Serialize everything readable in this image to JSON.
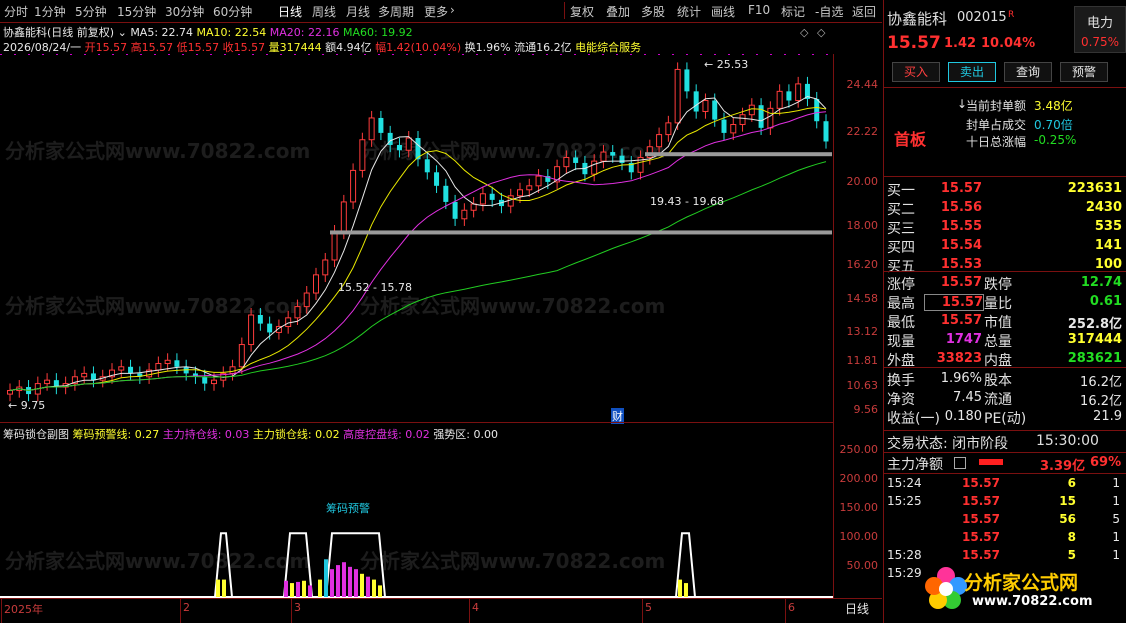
{
  "toolbar": {
    "periods": [
      "分时",
      "1分钟",
      "5分钟",
      "15分钟",
      "30分钟",
      "60分钟",
      "日线",
      "周线",
      "月线",
      "多周期",
      "更多"
    ],
    "tools": [
      "复权",
      "叠加",
      "多股",
      "统计",
      "画线",
      "F10",
      "标记",
      "-自选",
      "返回"
    ]
  },
  "chart_header": {
    "title": "协鑫能科(日线 前复权)",
    "ma5": "MA5: 22.74",
    "ma10": "MA10: 22.54",
    "ma20": "MA20: 22.16",
    "ma60": "MA60: 19.92"
  },
  "quote_line": {
    "date": "2026/08/24/一",
    "open": "开15.57",
    "high": "高15.57",
    "low": "低15.57",
    "close": "收15.57",
    "volume": "量317444",
    "amount": "额4.94亿",
    "change": "幅1.42(10.04%)",
    "turnover": "换1.96%",
    "float": "流通16.2亿",
    "industry": "电能综合服务"
  },
  "price_axis": [
    "24.44",
    "22.22",
    "20.00",
    "18.00",
    "16.20",
    "14.58",
    "13.12",
    "11.81",
    "10.63",
    "9.56"
  ],
  "annotations": {
    "high": "25.53",
    "low": "9.75",
    "range1": "15.52 - 15.78",
    "range2": "19.43 - 19.68",
    "cai": "财"
  },
  "sub_header": {
    "title": "筹码锁仓副图",
    "warn": "筹码预警线: 0.27",
    "hold": "主力持仓线: 0.03",
    "lock": "主力锁仓线: 0.02",
    "control": "高度控盘线: 0.02",
    "strong": "强势区: 0.00"
  },
  "sub_axis": [
    "250.00",
    "200.00",
    "150.00",
    "100.00",
    "50.00"
  ],
  "sub_label": "筹码预警",
  "x_axis": [
    "2025年",
    "2",
    "3",
    "4",
    "5",
    "6"
  ],
  "period_tag": "日线",
  "watermark": "分析家公式网www.70822.com",
  "chart_data": {
    "type": "candlestick",
    "title": "协鑫能科(日线 前复权)",
    "ylim": [
      9.56,
      25.53
    ],
    "x_ticks": [
      "2025年",
      "2",
      "3",
      "4",
      "5",
      "6"
    ],
    "high_marker": 25.53,
    "low_marker": 9.75,
    "levels": [
      [
        15.52,
        15.78
      ],
      [
        19.43,
        19.68
      ]
    ],
    "series": [
      {
        "name": "MA5",
        "last": 22.74
      },
      {
        "name": "MA10",
        "last": 22.54
      },
      {
        "name": "MA20",
        "last": 22.16
      },
      {
        "name": "MA60",
        "last": 19.92
      }
    ],
    "closes": [
      10.1,
      10.2,
      10.0,
      10.3,
      10.4,
      10.2,
      10.3,
      10.5,
      10.6,
      10.4,
      10.5,
      10.7,
      10.8,
      10.6,
      10.5,
      10.7,
      10.9,
      11.0,
      10.8,
      10.6,
      10.5,
      10.3,
      10.4,
      10.6,
      10.8,
      11.5,
      12.5,
      12.2,
      11.9,
      12.1,
      12.4,
      12.8,
      13.3,
      14.0,
      14.6,
      15.8,
      17.2,
      18.8,
      20.5,
      21.8,
      20.9,
      20.2,
      19.9,
      20.6,
      19.4,
      18.7,
      18.0,
      17.2,
      16.4,
      16.8,
      17.1,
      17.6,
      17.3,
      17.0,
      17.5,
      17.8,
      18.0,
      18.5,
      18.2,
      19.0,
      19.5,
      19.2,
      18.6,
      19.3,
      19.8,
      19.6,
      19.2,
      18.7,
      19.5,
      20.1,
      20.8,
      21.5,
      25.0,
      23.5,
      22.2,
      22.9,
      21.7,
      20.9,
      21.4,
      22.0,
      22.6,
      21.2,
      22.4,
      23.5,
      22.9,
      24.0,
      23.0,
      21.6,
      20.4
    ],
    "sub_chart": {
      "title": "筹码锁仓副图",
      "ylim": [
        0,
        250
      ],
      "warn_line": 0.27,
      "hold_line": 0.03,
      "lock_line": 0.02,
      "control_line": 0.02,
      "strong_zone": 0.0
    }
  },
  "stock": {
    "name": "协鑫能科",
    "code": "002015",
    "flag": "R",
    "sector": "电力",
    "price": "15.57",
    "change": "1.42",
    "pct": "10.04%",
    "sector_pct": "0.75%",
    "buttons": [
      "买入",
      "卖出",
      "查询",
      "预警"
    ],
    "limit_label": "首板",
    "seal_rows": [
      {
        "label": "当前封单额",
        "value": "3.48亿"
      },
      {
        "label": "封单占成交",
        "value": "0.70倍"
      },
      {
        "label": "十日总涨幅",
        "value": "-0.25%"
      }
    ]
  },
  "orderbook": [
    {
      "label": "买一",
      "price": "15.57",
      "vol": "223631"
    },
    {
      "label": "买二",
      "price": "15.56",
      "vol": "2430"
    },
    {
      "label": "买三",
      "price": "15.55",
      "vol": "535"
    },
    {
      "label": "买四",
      "price": "15.54",
      "vol": "141"
    },
    {
      "label": "买五",
      "price": "15.53",
      "vol": "100"
    }
  ],
  "stats": [
    {
      "l1": "涨停",
      "v1": "15.57",
      "l2": "跌停",
      "v2": "12.74"
    },
    {
      "l1": "最高",
      "v1": "15.57",
      "l2": "量比",
      "v2": "0.61"
    },
    {
      "l1": "最低",
      "v1": "15.57",
      "l2": "市值",
      "v2": "252.8亿"
    },
    {
      "l1": "现量",
      "v1": "1747",
      "l2": "总量",
      "v2": "317444"
    },
    {
      "l1": "外盘",
      "v1": "33823",
      "l2": "内盘",
      "v2": "283621"
    }
  ],
  "stats2": [
    {
      "l1": "换手",
      "v1": "1.96%",
      "l2": "股本",
      "v2": "16.2亿"
    },
    {
      "l1": "净资",
      "v1": "7.45",
      "l2": "流通",
      "v2": "16.2亿"
    },
    {
      "l1": "收益(一)",
      "v1": "0.180",
      "l2": "PE(动)",
      "v2": "21.9"
    }
  ],
  "status": {
    "state": "交易状态: 闭市阶段",
    "time": "15:30:00",
    "main_net": "主力净额",
    "main_val": "3.39亿",
    "main_pct": "69%"
  },
  "ticks": [
    {
      "t": "15:24",
      "p": "15.57",
      "v": "6",
      "n": "1"
    },
    {
      "t": "15:25",
      "p": "15.57",
      "v": "15",
      "n": "1"
    },
    {
      "t": "",
      "p": "15.57",
      "v": "56",
      "n": "5"
    },
    {
      "t": "",
      "p": "15.57",
      "v": "8",
      "n": "1"
    },
    {
      "t": "15:28",
      "p": "15.57",
      "v": "5",
      "n": "1"
    },
    {
      "t": "15:29",
      "p": "",
      "v": "",
      "n": ""
    }
  ],
  "logo": {
    "text": "分析家公式网",
    "url": "www.70822.com"
  }
}
